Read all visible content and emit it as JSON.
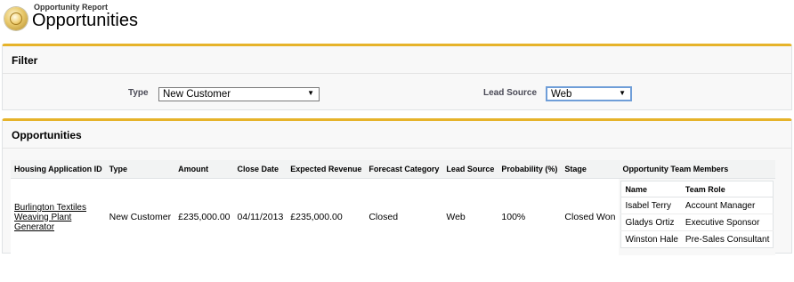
{
  "header": {
    "subtitle": "Opportunity Report",
    "title": "Opportunities"
  },
  "filter": {
    "heading": "Filter",
    "type_label": "Type",
    "type_value": "New Customer",
    "lead_source_label": "Lead Source",
    "lead_source_value": "Web"
  },
  "opportunities": {
    "heading": "Opportunities",
    "columns": [
      "Housing Application ID",
      "Type",
      "Amount",
      "Close Date",
      "Expected Revenue",
      "Forecast Category",
      "Lead Source",
      "Probability (%)",
      "Stage",
      "Opportunity Team Members"
    ],
    "rows": [
      {
        "name_lines": [
          "Burlington Textiles",
          "Weaving Plant",
          "Generator"
        ],
        "type": "New Customer",
        "amount": "£235,000.00",
        "close_date": "04/11/2013",
        "expected_revenue": "£235,000.00",
        "forecast_category": "Closed",
        "lead_source": "Web",
        "probability": "100%",
        "stage": "Closed Won",
        "team": {
          "columns": [
            "Name",
            "Team Role"
          ],
          "members": [
            {
              "name": "Isabel Terry",
              "role": "Account Manager"
            },
            {
              "name": "Gladys Ortiz",
              "role": "Executive Sponsor"
            },
            {
              "name": "Winston Hale",
              "role": "Pre-Sales Consultant"
            }
          ]
        }
      }
    ]
  },
  "icons": {
    "header": "opportunity-coin-icon",
    "dropdown": "dropdown-arrow-icon"
  }
}
